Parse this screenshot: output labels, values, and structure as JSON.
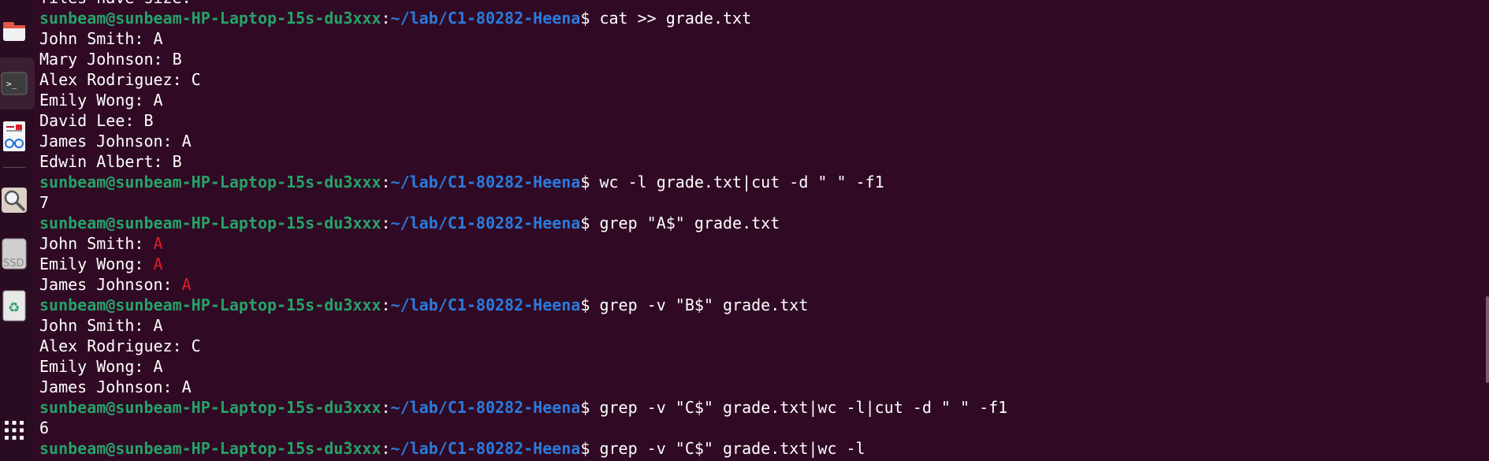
{
  "dock": {
    "items": [
      {
        "name": "files",
        "icon": "folder-icon"
      },
      {
        "name": "terminal",
        "icon": "terminal-icon",
        "glyph": ">_"
      },
      {
        "name": "text-editor",
        "icon": "document-viewer-icon"
      },
      {
        "name": "search",
        "icon": "magnifier-icon"
      },
      {
        "name": "ssd",
        "icon": "drive-icon",
        "label": "SSD"
      },
      {
        "name": "trash",
        "icon": "recycle-icon",
        "glyph": "♻"
      },
      {
        "name": "apps",
        "icon": "app-grid-icon"
      }
    ]
  },
  "terminal": {
    "prompt_user": "sunbeam@sunbeam-HP-Laptop-15s-du3xxx",
    "prompt_path": "~/lab/C1-80282-Heena",
    "lines": [
      {
        "type": "out",
        "text": "files have size."
      },
      {
        "type": "cmd",
        "text": "cat >> grade.txt"
      },
      {
        "type": "out",
        "text": "John Smith: A"
      },
      {
        "type": "out",
        "text": "Mary Johnson: B"
      },
      {
        "type": "out",
        "text": "Alex Rodriguez: C"
      },
      {
        "type": "out",
        "text": "Emily Wong: A"
      },
      {
        "type": "out",
        "text": "David Lee: B"
      },
      {
        "type": "out",
        "text": "James Johnson: A"
      },
      {
        "type": "out",
        "text": "Edwin Albert: B"
      },
      {
        "type": "cmd",
        "text": "wc -l grade.txt|cut -d \" \" -f1"
      },
      {
        "type": "out",
        "text": "7"
      },
      {
        "type": "cmd",
        "text": "grep \"A$\" grade.txt"
      },
      {
        "type": "hl",
        "text": "John Smith: ",
        "match": "A"
      },
      {
        "type": "hl",
        "text": "Emily Wong: ",
        "match": "A"
      },
      {
        "type": "hl",
        "text": "James Johnson: ",
        "match": "A"
      },
      {
        "type": "cmd",
        "text": "grep -v \"B$\" grade.txt"
      },
      {
        "type": "out",
        "text": "John Smith: A"
      },
      {
        "type": "out",
        "text": "Alex Rodriguez: C"
      },
      {
        "type": "out",
        "text": "Emily Wong: A"
      },
      {
        "type": "out",
        "text": "James Johnson: A"
      },
      {
        "type": "cmd",
        "text": "grep -v \"C$\" grade.txt|wc -l|cut -d \" \" -f1"
      },
      {
        "type": "out",
        "text": "6"
      },
      {
        "type": "cmd",
        "text": "grep -v \"C$\" grade.txt|wc -l"
      }
    ],
    "colors": {
      "background": "#300a24",
      "user": "#26a269",
      "path": "#2a7bde",
      "match": "#e01b24",
      "text": "#ffffff"
    }
  }
}
